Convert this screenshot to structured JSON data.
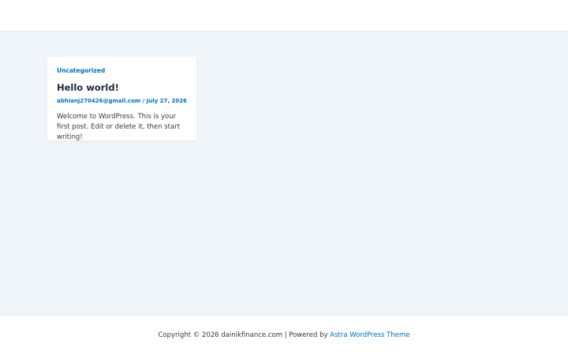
{
  "post": {
    "category": "Uncategorized",
    "title": "Hello world!",
    "author": "abhianj270426@gmail.com",
    "separator": "/",
    "date": "July 27, 2026",
    "excerpt": "Welcome to WordPress. This is your first post. Edit or delete it, then start writing!"
  },
  "footer": {
    "copyright": "Copyright © 2026 dainikfinance.com | Powered by",
    "theme_link": "Astra WordPress Theme"
  },
  "colors": {
    "accent": "#0170b9",
    "page_background": "#f0f5fa"
  }
}
